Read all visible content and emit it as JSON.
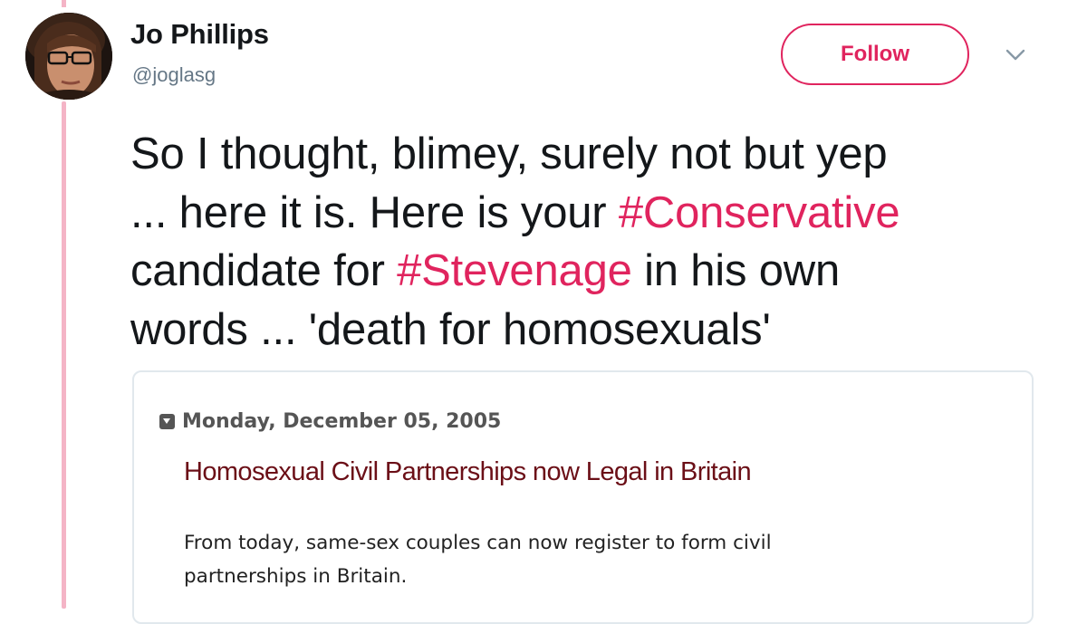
{
  "author": {
    "name": "Jo Phillips",
    "handle": "@joglasg"
  },
  "actions": {
    "follow_label": "Follow",
    "more_icon": "chevron-down-icon"
  },
  "tweet": {
    "line1": "So I thought, blimey, surely not but yep",
    "line2_prefix": "... here it is. Here is your ",
    "hashtag1": "#Conservative",
    "line3_prefix": "candidate for ",
    "hashtag2": "#Stevenage",
    "line3_suffix": " in his own",
    "line4": "words ... 'death for homosexuals'"
  },
  "card": {
    "date": "Monday, December 05, 2005",
    "title": "Homosexual Civil Partnerships now Legal in Britain",
    "body_line1": "From today, same-sex couples can now register to form civil",
    "body_line2": "partnerships in Britain."
  },
  "colors": {
    "accent": "#e0245e",
    "thread_line": "#f4b4c6",
    "card_title": "#6b0f17"
  }
}
